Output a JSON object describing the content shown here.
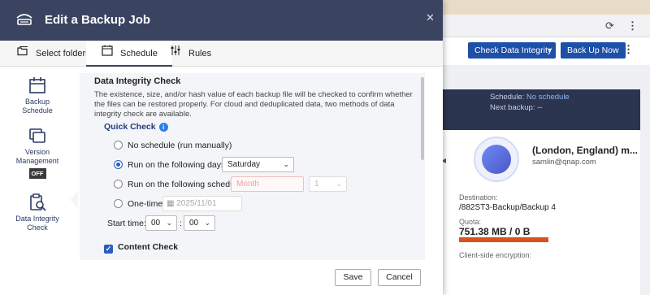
{
  "dialog": {
    "title": "Edit a Backup Job",
    "tabs": [
      {
        "label": "Select folders",
        "icon": "folders-icon"
      },
      {
        "label": "Schedule",
        "icon": "calendar-icon"
      },
      {
        "label": "Rules",
        "icon": "sliders-icon"
      }
    ],
    "active_tab": "Schedule",
    "sidebar": [
      {
        "label": "Backup Schedule",
        "icon": "calendar-icon"
      },
      {
        "label": "Version Management",
        "icon": "versions-icon",
        "badge": "OFF"
      },
      {
        "label": "Data Integrity Check",
        "icon": "clipboard-search-icon",
        "active": true
      }
    ],
    "section": {
      "title": "Data Integrity Check",
      "description": "The existence, size, and/or hash value of each backup file will be checked to confirm whether the files can be restored properly. For cloud and deduplicated data, two methods of data integrity check are available.",
      "quick_check_label": "Quick Check",
      "info_icon": "i",
      "options": [
        {
          "label": "No schedule (run manually)",
          "selected": false
        },
        {
          "label": "Run on the following days",
          "selected": true,
          "value": "Saturday"
        },
        {
          "label": "Run on the following schedule",
          "selected": false,
          "month_placeholder": "Month",
          "day_value": "1"
        },
        {
          "label": "One-time",
          "selected": false,
          "date_value": "2025/11/01"
        }
      ],
      "start_time_label": "Start time:",
      "hour": "00",
      "minute": "00",
      "time_sep": ":",
      "content_check_label": "Content Check",
      "content_check_checked": true
    },
    "save_label": "Save",
    "cancel_label": "Cancel"
  },
  "background": {
    "check_integrity_label": "Check Data Integrity",
    "backup_now_label": "Back Up Now",
    "partial_letter": "e",
    "schedule_label": "Schedule:",
    "schedule_value": "No schedule",
    "next_backup_label": "Next backup:",
    "next_backup_value": "--",
    "job_title": "(London, England) m...",
    "account": "samlin@qnap.com",
    "destination_label": "Destination:",
    "destination_value": "/882ST3-Backup/Backup 4",
    "quota_label": "Quota:",
    "quota_value": "751.38 MB / 0 B",
    "quota_fill": 1.0,
    "encryption_label": "Client-side encryption:",
    "accent_color": "#1e50a8",
    "quota_color": "#d9531e"
  }
}
